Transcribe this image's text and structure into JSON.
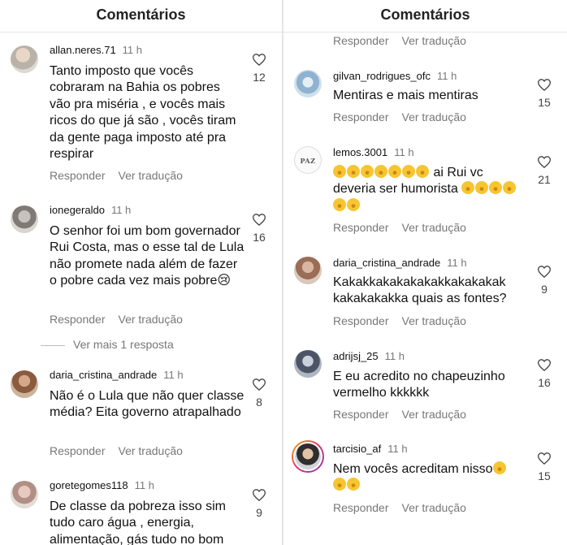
{
  "left": {
    "title": "Comentários",
    "comments": [
      {
        "user": "allan.neres.71",
        "time": "11 h",
        "text": "Tanto imposto que vocês cobraram na Bahia os pobres vão pra miséria , e vocês mais ricos do que já são , vocês tiram da gente paga imposto até pra respirar",
        "likes": "12"
      },
      {
        "user": "ionegeraldo",
        "time": "11 h",
        "text": "O senhor foi um bom governador Rui Costa, mas o esse tal de Lula não promete nada além de fazer o pobre cada vez mais pobre😢",
        "likes": "16"
      },
      {
        "user": "daria_cristina_andrade",
        "time": "11 h",
        "text": "Não é o Lula que não quer classe média? Eita governo atrapalhado",
        "likes": "8"
      },
      {
        "user": "goretegomes118",
        "time": "11 h",
        "text": "De classe da pobreza isso sim tudo caro água , energia, alimentação, gás tudo no bom",
        "likes": "9"
      }
    ],
    "more_replies": "Ver mais 1 resposta"
  },
  "right": {
    "title": "Comentários",
    "comments": [
      {
        "user": "gilvan_rodrigues_ofc",
        "time": "11 h",
        "text": "Mentiras e mais mentiras",
        "likes": "15"
      },
      {
        "user": "lemos.3001",
        "time": "11 h",
        "text": "ai Rui vc deveria ser humorista",
        "likes": "21",
        "avatar_text": "PAZ"
      },
      {
        "user": "daria_cristina_andrade",
        "time": "11 h",
        "text": "Kakakkakakakakakkakakakak kakakakakka quais as fontes?",
        "likes": "9"
      },
      {
        "user": "adrijsj_25",
        "time": "11 h",
        "text": "E eu acredito no chapeuzinho vermelho kkkkkk",
        "likes": "16"
      },
      {
        "user": "tarcisio_af",
        "time": "11 h",
        "text": "Nem vocês acreditam nisso",
        "likes": "15"
      }
    ]
  },
  "actions": {
    "reply": "Responder",
    "translate": "Ver tradução"
  },
  "icons": {
    "like": "heart-outline-icon",
    "emoji": "joy-emoji-icon"
  }
}
